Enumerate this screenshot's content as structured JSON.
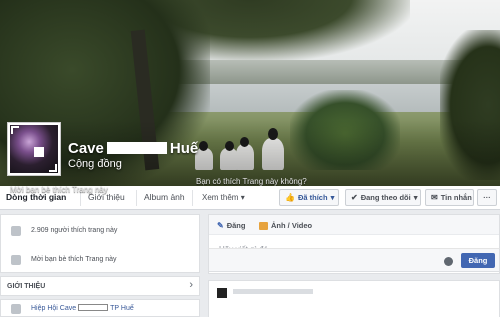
{
  "page": {
    "name_prefix": "Cave",
    "name_suffix": "Huế",
    "category": "Cộng đồng"
  },
  "cover_overlay": {
    "invite_text": "Mời bạn bè thích Trang này",
    "like_prompt": "Bạn có thích Trang này không?"
  },
  "tabs": [
    {
      "label": "Dòng thời gian",
      "active": true
    },
    {
      "label": "Giới thiệu",
      "active": false
    },
    {
      "label": "Album ảnh",
      "active": false
    },
    {
      "label": "Xem thêm",
      "active": false
    }
  ],
  "actions": {
    "liked": "Đã thích",
    "following": "Đang theo dõi",
    "message": "Tin nhắn"
  },
  "left": {
    "likes_count": "2.909 người thích trang này",
    "invite": "Mời bạn bè thích Trang này",
    "intro_title": "GIỚI THIỆU",
    "intro_item_prefix": "Hiệp Hội Cave",
    "intro_item_suffix": "TP Huế"
  },
  "composer": {
    "status_tab": "Đăng",
    "photo_tab": "Ảnh / Video",
    "placeholder": "Hãy viết gì đó...",
    "post_button": "Đăng"
  },
  "colors": {
    "accent": "#4267b2",
    "link": "#365899",
    "background": "#e9ebee"
  }
}
